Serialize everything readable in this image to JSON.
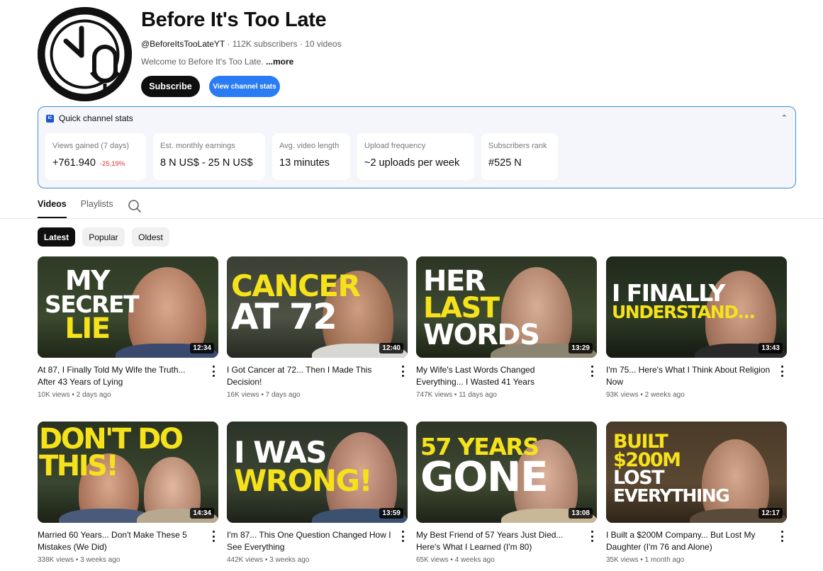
{
  "channel": {
    "name": "Before It's Too Late",
    "handle": "@BeforeItsTooLateYT",
    "subscribers": "112K subscribers",
    "videos_count": "10 videos",
    "separator": " · ",
    "description": "Welcome to Before It's Too Late. ",
    "more": "...more",
    "subscribe_label": "Subscribe",
    "view_stats_label": "View channel stats"
  },
  "quick_stats": {
    "title": "Quick channel stats",
    "logo_text": "IC",
    "collapse_icon": "chevron-up-icon",
    "cards": [
      {
        "label": "Views gained (7 days)",
        "value": "+761.940",
        "change": "-25,19%"
      },
      {
        "label": "Est. monthly earnings",
        "value": "8 N US$ - 25 N US$",
        "change": ""
      },
      {
        "label": "Avg. video length",
        "value": "13 minutes",
        "change": ""
      },
      {
        "label": "Upload frequency",
        "value": "~2 uploads per week",
        "change": ""
      },
      {
        "label": "Subscribers rank",
        "value": "#525 N",
        "change": ""
      }
    ]
  },
  "tabs": [
    {
      "label": "Videos",
      "active": true
    },
    {
      "label": "Playlists",
      "active": false
    }
  ],
  "search_icon": "search-icon",
  "chips": [
    {
      "label": "Latest",
      "active": true
    },
    {
      "label": "Popular",
      "active": false
    },
    {
      "label": "Oldest",
      "active": false
    }
  ],
  "videos": [
    {
      "thumb_lines": [
        "MY",
        "SECRET",
        "LIE"
      ],
      "duration": "12:34",
      "title": "At 87, I Finally Told My Wife the Truth... After 43 Years of Lying",
      "views": "10K views",
      "age": "2 days ago"
    },
    {
      "thumb_lines": [
        "CANCER",
        "AT 72"
      ],
      "duration": "12:40",
      "title": "I Got Cancer at 72... Then I Made This Decision!",
      "views": "16K views",
      "age": "7 days ago"
    },
    {
      "thumb_lines": [
        "HER",
        "LAST",
        "WORDS"
      ],
      "duration": "13:29",
      "title": "My Wife's Last Words Changed Everything... I Wasted 41 Years",
      "views": "747K views",
      "age": "11 days ago"
    },
    {
      "thumb_lines": [
        "I FINALLY",
        "UNDERSTAND..."
      ],
      "duration": "13:43",
      "title": "I'm 75... Here's What I Think About Religion Now",
      "views": "93K views",
      "age": "2 weeks ago"
    },
    {
      "thumb_lines": [
        "DON'T DO THIS!"
      ],
      "duration": "14:34",
      "title": "Married 60 Years... Don't Make These 5 Mistakes (We Did)",
      "views": "338K views",
      "age": "3 weeks ago"
    },
    {
      "thumb_lines": [
        "I WAS",
        "WRONG!"
      ],
      "duration": "13:59",
      "title": "I'm 87... This One Question Changed How I See Everything",
      "views": "442K views",
      "age": "3 weeks ago"
    },
    {
      "thumb_lines": [
        "57 YEARS",
        "GONE"
      ],
      "duration": "13:08",
      "title": "My Best Friend of 57 Years Just Died... Here's What I Learned (I'm 80)",
      "views": "65K views",
      "age": "4 weeks ago"
    },
    {
      "thumb_lines": [
        "BUILT",
        "$200M",
        "LOST",
        "EVERYTHING"
      ],
      "duration": "12:17",
      "title": "I Built a $200M Company... But Lost My Daughter (I'm 76 and Alone)",
      "views": "35K views",
      "age": "1 month ago"
    }
  ],
  "colors": {
    "accent_blue": "#2a7cf5",
    "stats_border": "#3b8ed6",
    "thumb_yellow": "#f5e21b",
    "negative": "#e03131"
  }
}
